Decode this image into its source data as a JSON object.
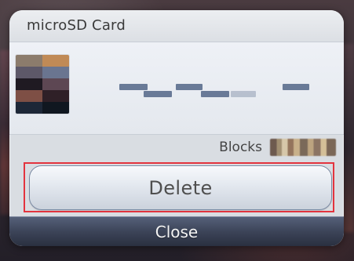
{
  "dialog": {
    "title": "microSD Card",
    "blocks_label": "Blocks",
    "delete_label": "Delete",
    "close_label": "Close"
  },
  "colors": {
    "highlight_outline": "#e3343e",
    "dialog_background": "#d9dde2",
    "bottom_bar": "#3b4357"
  },
  "thumbnail": {
    "pixels": [
      "#8c7c6c",
      "#c08a56",
      "#5d5868",
      "#6a7590",
      "#1f1a22",
      "#5d4753",
      "#7e4f45",
      "#2f2027",
      "#1d2737",
      "#101720"
    ]
  },
  "icons": {
    "highlight_marker": "selection-outline"
  }
}
